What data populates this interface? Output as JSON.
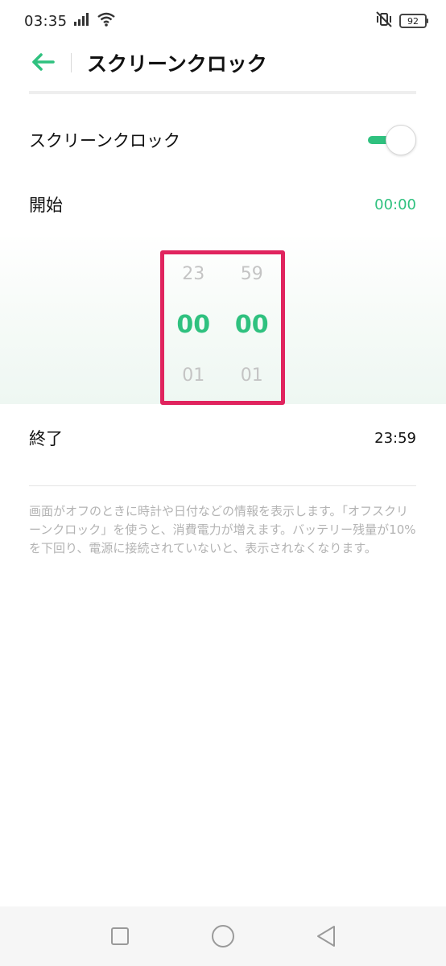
{
  "status_bar": {
    "time": "03:35",
    "battery": "92",
    "icons": [
      "signal-icon",
      "wifi-icon",
      "vibrate-mute-icon",
      "battery-icon"
    ]
  },
  "header": {
    "title": "スクリーンクロック",
    "back_icon": "arrow-left-icon"
  },
  "settings": {
    "toggle_label": "スクリーンクロック",
    "toggle_on": true,
    "start_label": "開始",
    "start_value": "00:00",
    "end_label": "終了",
    "end_value": "23:59"
  },
  "picker": {
    "hours": {
      "prev": "23",
      "selected": "00",
      "next": "01"
    },
    "minutes": {
      "prev": "59",
      "selected": "00",
      "next": "01"
    }
  },
  "footnote": "画面がオフのときに時計や日付などの情報を表示します。「オフスクリーンクロック」を使うと、消費電力が増えます。バッテリー残量が10%を下回り、電源に接続されていないと、表示されなくなります。",
  "colors": {
    "accent": "#2fc17f",
    "highlight_border": "#e0245e",
    "muted_text": "#b3b3b3"
  },
  "nav_bar": {
    "icons": [
      "recents-square-icon",
      "home-circle-icon",
      "back-triangle-icon"
    ]
  }
}
